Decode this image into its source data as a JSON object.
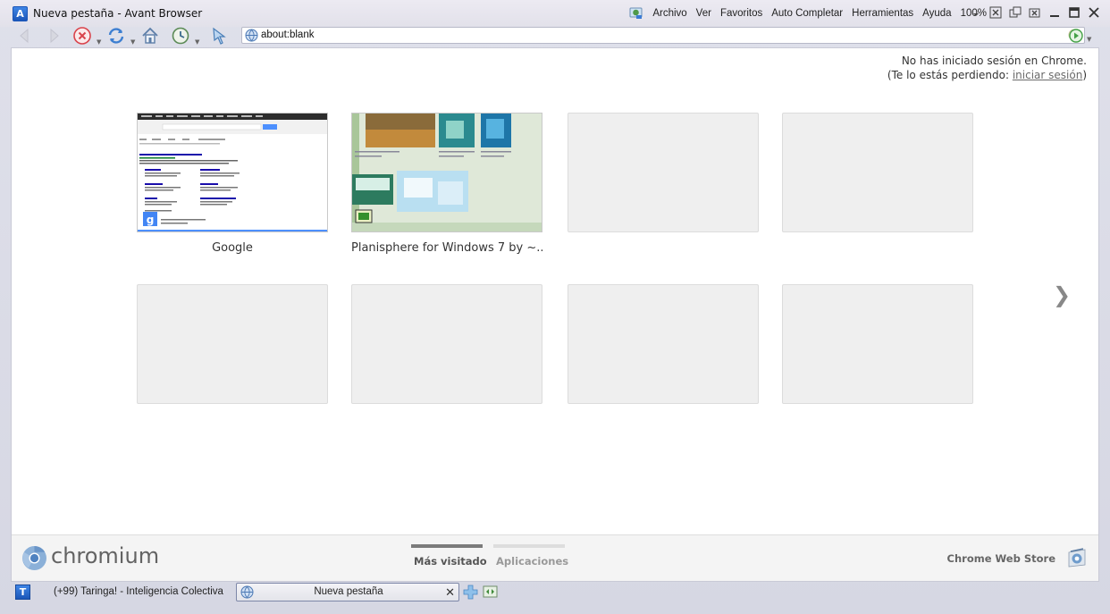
{
  "window": {
    "title": "Nueva pestaña - Avant Browser",
    "logo_letter": "A"
  },
  "menu": {
    "items": [
      "Archivo",
      "Ver",
      "Favoritos",
      "Auto Completar",
      "Herramientas",
      "Ayuda",
      "100%"
    ]
  },
  "address": {
    "url": "about:blank"
  },
  "content": {
    "signin_line1": "No has iniciado sesión en Chrome.",
    "signin_prefix": "(Te lo estás perdiendo: ",
    "signin_link": "iniciar sesión",
    "signin_suffix": ")",
    "tiles": [
      {
        "caption": "Google",
        "thumb": "google"
      },
      {
        "caption": "Planisphere for Windows 7 by ~...",
        "thumb": "planisphere"
      },
      {
        "caption": "",
        "thumb": "empty"
      },
      {
        "caption": "",
        "thumb": "empty"
      },
      {
        "caption": "",
        "thumb": "empty"
      },
      {
        "caption": "",
        "thumb": "empty"
      },
      {
        "caption": "",
        "thumb": "empty"
      },
      {
        "caption": "",
        "thumb": "empty"
      }
    ],
    "next_arrow": "❯"
  },
  "footer": {
    "brand": "chromium",
    "tab_most_visited": "Más visitado",
    "tab_apps": "Aplicaciones",
    "store": "Chrome Web Store"
  },
  "tabbar": {
    "logo_letter": "T",
    "inactive_tab": "(+99) Taringa! - Inteligencia Colectiva",
    "active_tab": "Nueva pestaña",
    "close_glyph": "✕"
  },
  "colors": {
    "accent_blue": "#1b56b8",
    "content_bg": "#ffffff",
    "tile_bg": "#efefef"
  }
}
